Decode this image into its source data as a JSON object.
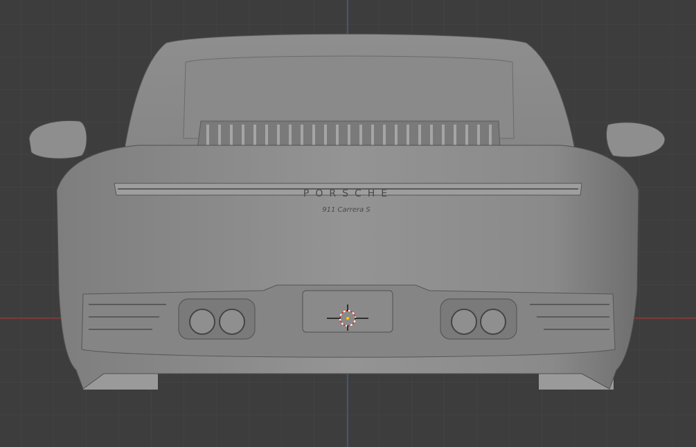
{
  "app": {
    "view": "3D Viewport",
    "mode": "Orthographic Back"
  },
  "model": {
    "name": "Porsche 911 Carrera S",
    "brand_lettering": "PORSCHE",
    "badge": "911 Carrera S"
  },
  "colors": {
    "background": "#3d3d3d",
    "grid": "#474747",
    "x_axis": "#8a3a3a",
    "z_axis": "#3d5f8f",
    "body": "#8c8c8c",
    "cursor": "#d03a2e"
  }
}
